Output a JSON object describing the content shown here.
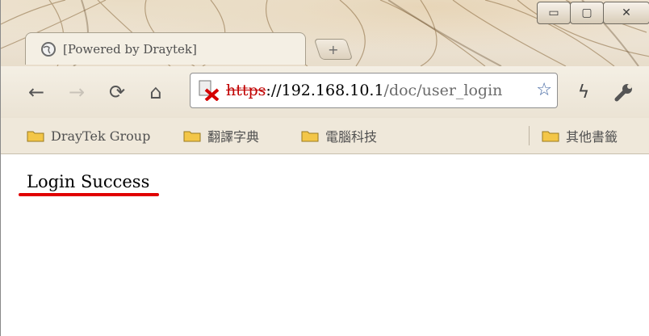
{
  "tab": {
    "title": "[Powered by Draytek]",
    "icon": "globe-icon"
  },
  "window_controls": {
    "minimize_icon": "minimize-icon",
    "maximize_icon": "maximize-icon",
    "close_icon": "close-icon"
  },
  "toolbar": {
    "back_icon": "back-arrow-icon",
    "forward_icon": "forward-arrow-icon",
    "reload_icon": "reload-icon",
    "home_icon": "home-icon",
    "page_action_icon": "lightning-icon",
    "wrench_icon": "wrench-icon"
  },
  "address": {
    "scheme": "https",
    "host": "://192.168.10.1",
    "path": "/doc/user_login",
    "security_icon": "certificate-error-icon",
    "bookmark_star_icon": "star-icon"
  },
  "bookmarks": {
    "items": [
      {
        "label": "DrayTek Group"
      },
      {
        "label": "翻譯字典"
      },
      {
        "label": "電腦科技"
      }
    ],
    "other_label": "其他書籤"
  },
  "page": {
    "message": "Login Success"
  },
  "colors": {
    "scheme_error": "#c00000",
    "underline": "#e00000",
    "star": "#3f64a0"
  }
}
